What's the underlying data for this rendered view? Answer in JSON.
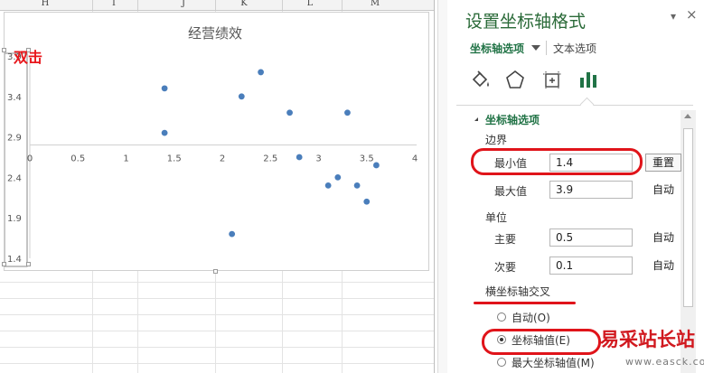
{
  "sheet": {
    "columns": [
      "H",
      "I",
      "J",
      "K",
      "L",
      "M"
    ]
  },
  "annotation": "双击",
  "chart_data": {
    "type": "scatter",
    "title": "经营绩效",
    "xlim": [
      0,
      4
    ],
    "ylim": [
      1.4,
      3.9
    ],
    "x_ticks": [
      0,
      0.5,
      1,
      1.5,
      2,
      2.5,
      3,
      3.5,
      4
    ],
    "x_tick_labels": [
      "0",
      "0.5",
      "1",
      "1.5",
      "2",
      "2.5",
      "3",
      "3.5",
      "4"
    ],
    "y_ticks": [
      1.4,
      1.9,
      2.4,
      2.9,
      3.4,
      3.9
    ],
    "y_tick_labels": [
      "1.4",
      "1.9",
      "2.4",
      "2.9",
      "3.4",
      "3.9"
    ],
    "horizontal_axis_crosses_at": 2.8,
    "grid": false,
    "point_color": "#4a7ebb",
    "points": [
      {
        "x": 1.4,
        "y": 3.5
      },
      {
        "x": 1.4,
        "y": 2.95
      },
      {
        "x": 2.2,
        "y": 3.4
      },
      {
        "x": 2.4,
        "y": 3.7
      },
      {
        "x": 2.7,
        "y": 3.2
      },
      {
        "x": 3.3,
        "y": 3.2
      },
      {
        "x": 2.8,
        "y": 2.65
      },
      {
        "x": 3.6,
        "y": 2.55
      },
      {
        "x": 3.2,
        "y": 2.4
      },
      {
        "x": 3.1,
        "y": 2.3
      },
      {
        "x": 3.4,
        "y": 2.3
      },
      {
        "x": 3.5,
        "y": 2.1
      },
      {
        "x": 2.1,
        "y": 1.7
      }
    ]
  },
  "pane": {
    "title": "设置坐标轴格式",
    "pin_icon": "pin-icon",
    "close_label": "×",
    "tabs": {
      "axis_options": "坐标轴选项",
      "text_options": "文本选项"
    },
    "icons": [
      "fill-line-icon",
      "effects-pentagon-icon",
      "size-properties-icon",
      "axis-options-bar-icon"
    ],
    "section_title": "坐标轴选项",
    "bounds": {
      "label": "边界",
      "min_label": "最小值",
      "min_value": "1.4",
      "min_button": "重置",
      "max_label": "最大值",
      "max_value": "3.9",
      "max_button": "自动"
    },
    "units": {
      "label": "单位",
      "major_label": "主要",
      "major_value": "0.5",
      "major_button": "自动",
      "minor_label": "次要",
      "minor_value": "0.1",
      "minor_button": "自动"
    },
    "cross": {
      "label": "横坐标轴交叉",
      "auto": "自动(O)",
      "axis_value": "坐标轴值(E)",
      "max_value": "最大坐标轴值(M)",
      "selected": "axis_value"
    }
  },
  "watermark": {
    "main": "易采站长站",
    "url": "www.easck.com"
  },
  "colors": {
    "accent_green": "#217346",
    "highlight_red": "#e0141a"
  }
}
